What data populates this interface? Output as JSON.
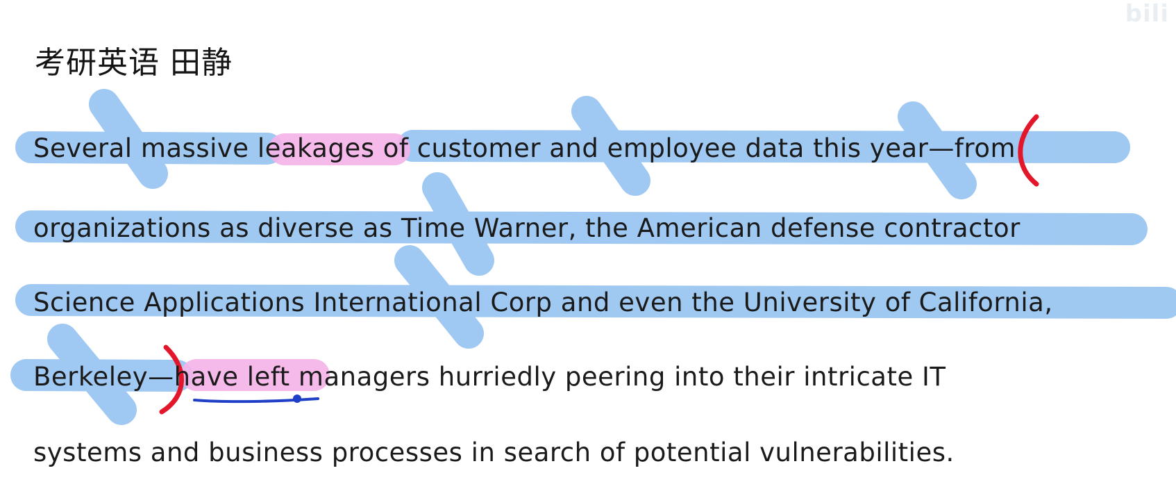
{
  "watermark": "bili",
  "title": "考研英语 田静",
  "passage": {
    "line1": {
      "a": "Several massive",
      "b": "leakages",
      "c": "of customer and employee data this year",
      "d": "—",
      "e": "from"
    },
    "line2": "organizations as diverse as Time Warner, the American defense contractor",
    "line3": "Science Applications International Corp and even the University of California,",
    "line4": {
      "a": "Berkeley",
      "b": "—",
      "c": "have left",
      "d": "managers hurriedly peering into their intricate IT"
    },
    "line5": "systems and business processes in search of potential vulnerabilities."
  },
  "colors": {
    "blue_highlight": "#8fbff0",
    "pink_highlight": "#f5b3e8",
    "red_bracket": "#e3172b",
    "blue_underline": "#1f3fc8"
  }
}
